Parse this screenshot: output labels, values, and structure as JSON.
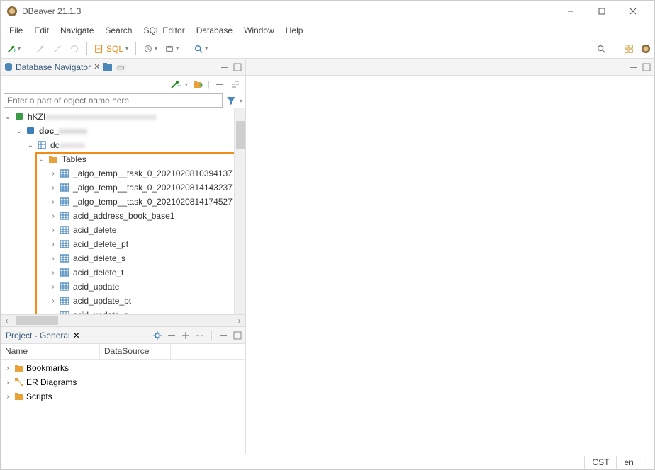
{
  "title": "DBeaver 21.1.3",
  "menubar": [
    "File",
    "Edit",
    "Navigate",
    "Search",
    "SQL Editor",
    "Database",
    "Window",
    "Help"
  ],
  "toolbar": {
    "sql_label": "SQL"
  },
  "navigator": {
    "title": "Database Navigator",
    "filter_placeholder": "Enter a part of object name here",
    "root_conn": "hKZI",
    "db_node": "doc_",
    "schema_node": "dc",
    "tables_label": "Tables",
    "tables": [
      "_algo_temp__task_0_2021020810394137",
      "_algo_temp__task_0_2021020814143237",
      "_algo_temp__task_0_2021020814174527",
      "acid_address_book_base1",
      "acid_delete",
      "acid_delete_pt",
      "acid_delete_s",
      "acid_delete_t",
      "acid_update",
      "acid_update_pt",
      "acid_update_s"
    ]
  },
  "project": {
    "title": "Project - General",
    "cols": [
      "Name",
      "DataSource"
    ],
    "items": [
      "Bookmarks",
      "ER Diagrams",
      "Scripts"
    ]
  },
  "status": {
    "tz": "CST",
    "lang": "en"
  }
}
